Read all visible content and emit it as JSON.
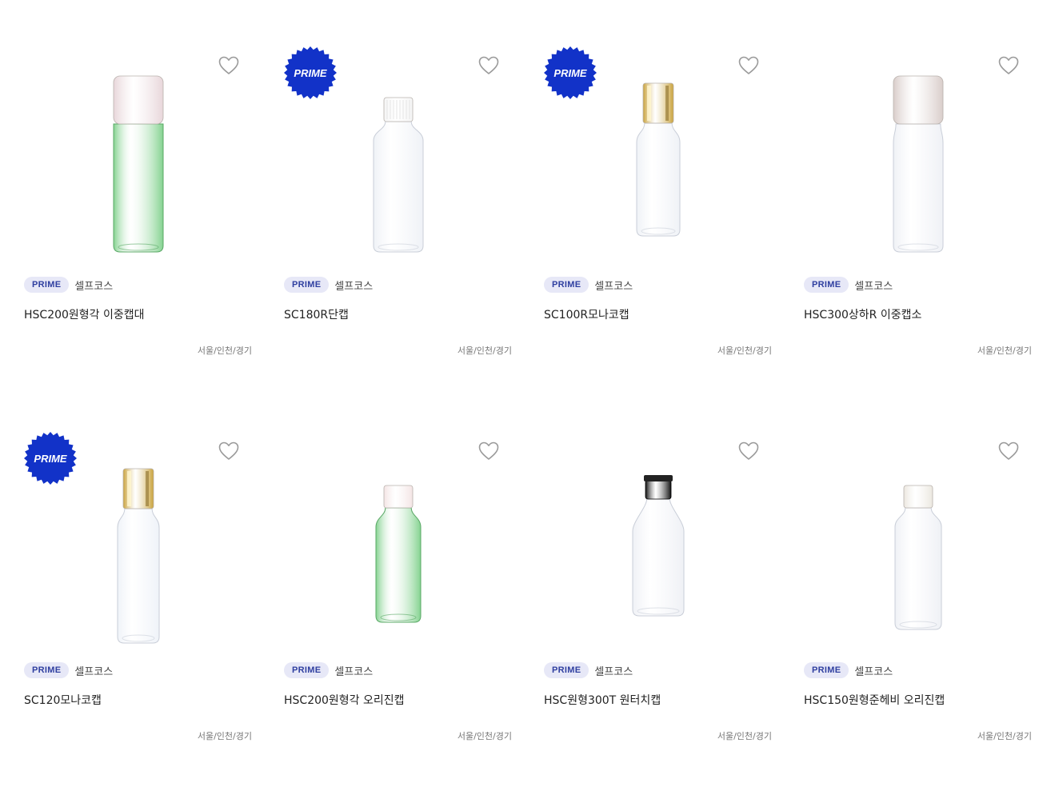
{
  "products": [
    {
      "name": "HSC200원형각 이중캡대",
      "brand": "셀프코스",
      "tag": "PRIME",
      "region": "서울/인천/경기",
      "prime_badge": false,
      "prime_badge_text": "PRIME",
      "cap_color": "#e8d6da",
      "body_color": "#7ed08a",
      "cap_type": "tall",
      "body_shape": "cyl"
    },
    {
      "name": "SC180R단캡",
      "brand": "셀프코스",
      "tag": "PRIME",
      "region": "서울/인천/경기",
      "prime_badge": true,
      "prime_badge_text": "PRIME",
      "cap_color": "#f4f4f4",
      "body_color": "#eef1f6",
      "cap_type": "ribbed",
      "body_shape": "round"
    },
    {
      "name": "SC100R모나코캡",
      "brand": "셀프코스",
      "tag": "PRIME",
      "region": "서울/인천/경기",
      "prime_badge": true,
      "prime_badge_text": "PRIME",
      "cap_color": "#c9a23a",
      "body_color": "#eef1f6",
      "cap_type": "gold",
      "body_shape": "round"
    },
    {
      "name": "HSC300상하R 이중캡소",
      "brand": "셀프코스",
      "tag": "PRIME",
      "region": "서울/인천/경기",
      "prime_badge": false,
      "prime_badge_text": "PRIME",
      "cap_color": "#d9cdca",
      "body_color": "#eef0f5",
      "cap_type": "tall",
      "body_shape": "round"
    },
    {
      "name": "SC120모나코캡",
      "brand": "셀프코스",
      "tag": "PRIME",
      "region": "서울/인천/경기",
      "prime_badge": true,
      "prime_badge_text": "PRIME",
      "cap_color": "#c9a23a",
      "body_color": "#eef2f8",
      "cap_type": "gold",
      "body_shape": "cyl"
    },
    {
      "name": "HSC200원형각 오리진캡",
      "brand": "셀프코스",
      "tag": "PRIME",
      "region": "서울/인천/경기",
      "prime_badge": false,
      "prime_badge_text": "PRIME",
      "cap_color": "#f3e4e4",
      "body_color": "#7ed08a",
      "cap_type": "short",
      "body_shape": "cyl"
    },
    {
      "name": "HSC원형300T 원터치캡",
      "brand": "셀프코스",
      "tag": "PRIME",
      "region": "서울/인천/경기",
      "prime_badge": false,
      "prime_badge_text": "PRIME",
      "cap_color": "#111111",
      "body_color": "#eef0f5",
      "cap_type": "flip",
      "body_shape": "wide"
    },
    {
      "name": "HSC150원형준헤비 오리진캡",
      "brand": "셀프코스",
      "tag": "PRIME",
      "region": "서울/인천/경기",
      "prime_badge": false,
      "prime_badge_text": "PRIME",
      "cap_color": "#ebe7df",
      "body_color": "#eef0f5",
      "cap_type": "short",
      "body_shape": "cyl"
    }
  ],
  "colors": {
    "tag_bg": "#e7e8f7",
    "tag_text": "#2f3fa0",
    "prime_badge": "#1232c8",
    "heart_stroke": "#9a9a9a"
  }
}
